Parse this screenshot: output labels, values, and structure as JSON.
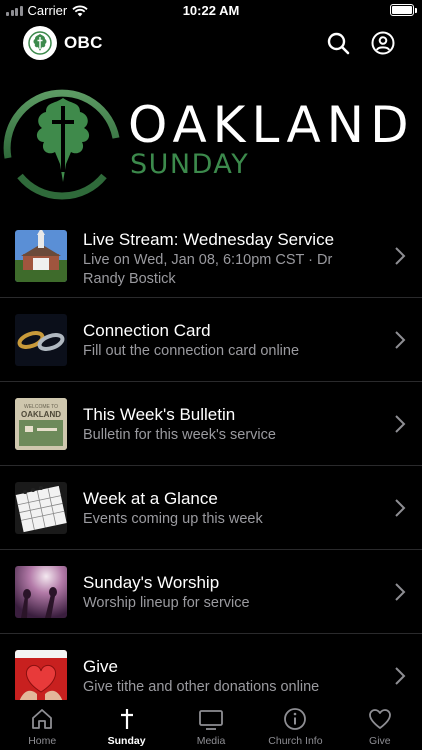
{
  "status_bar": {
    "carrier": "Carrier",
    "time": "10:22 AM"
  },
  "header": {
    "title": "OBC",
    "logo_icon": "oak-leaf-cross-icon"
  },
  "banner": {
    "title": "OAKLAND",
    "subtitle": "SUNDAY",
    "accent_color": "#3c8a4c"
  },
  "items": [
    {
      "title": "Live Stream: Wednesday Service",
      "subtitle": "Live on Wed, Jan 08, 6:10pm CST · Dr Randy Bostick",
      "icon": "church-photo-thumbnail"
    },
    {
      "title": "Connection Card",
      "subtitle": "Fill out the connection card online",
      "icon": "chain-links-thumbnail"
    },
    {
      "title": "This Week's Bulletin",
      "subtitle": "Bulletin for this week's service",
      "icon": "bulletin-thumbnail",
      "thumb_text_1": "WELCOME TO",
      "thumb_text_2": "OAKLAND"
    },
    {
      "title": "Week at a Glance",
      "subtitle": "Events coming up this week",
      "icon": "calendar-thumbnail"
    },
    {
      "title": "Sunday's Worship",
      "subtitle": "Worship lineup for service",
      "icon": "worship-hands-thumbnail"
    },
    {
      "title": "Give",
      "subtitle": "Give tithe and other donations online",
      "icon": "heart-hands-thumbnail"
    }
  ],
  "tabs": [
    {
      "label": "Home",
      "icon": "home-icon",
      "active": false
    },
    {
      "label": "Sunday",
      "icon": "cross-icon",
      "active": true
    },
    {
      "label": "Media",
      "icon": "tv-icon",
      "active": false
    },
    {
      "label": "Church Info",
      "icon": "info-icon",
      "active": false
    },
    {
      "label": "Give",
      "icon": "heart-icon",
      "active": false
    }
  ]
}
